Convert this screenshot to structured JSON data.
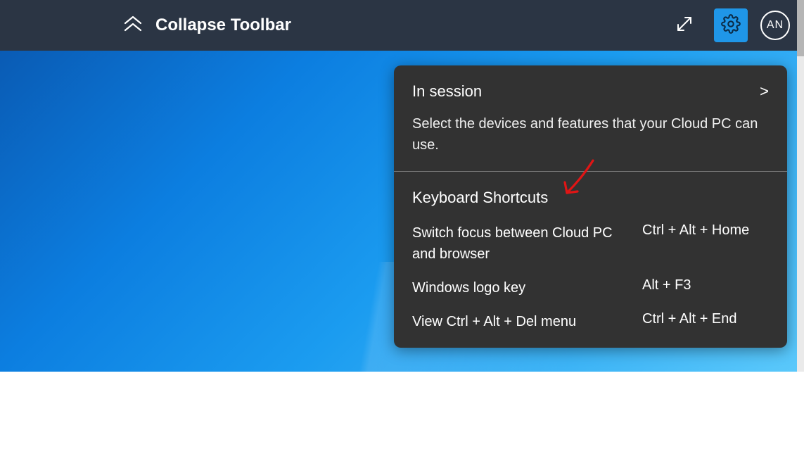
{
  "toolbar": {
    "collapse_label": "Collapse Toolbar",
    "avatar_initials": "AN"
  },
  "panel": {
    "in_session_title": "In session",
    "in_session_chevron": ">",
    "in_session_desc": "Select the devices and features that your Cloud PC can use.",
    "shortcuts_title": "Keyboard Shortcuts",
    "shortcuts": [
      {
        "label": "Switch focus between Cloud PC and browser",
        "key": "Ctrl + Alt + Home"
      },
      {
        "label": "Windows logo key",
        "key": "Alt + F3"
      },
      {
        "label": "View Ctrl + Alt + Del menu",
        "key": "Ctrl + Alt + End"
      }
    ]
  }
}
